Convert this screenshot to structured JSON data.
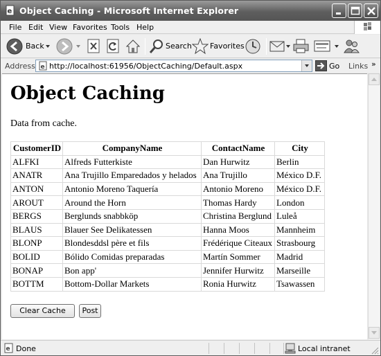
{
  "window": {
    "title": "Object Caching - Microsoft Internet Explorer"
  },
  "menu": {
    "items": [
      "File",
      "Edit",
      "View",
      "Favorites",
      "Tools",
      "Help"
    ]
  },
  "toolbar": {
    "back_label": "Back",
    "search_label": "Search",
    "favorites_label": "Favorites"
  },
  "address": {
    "label": "Address",
    "url": "http://localhost:61956/ObjectCaching/Default.aspx",
    "go_label": "Go",
    "links_label": "Links"
  },
  "page": {
    "title": "Object Caching",
    "intro": "Data from cache.",
    "table": {
      "headers": [
        "CustomerID",
        "CompanyName",
        "ContactName",
        "City"
      ],
      "rows": [
        [
          "ALFKI",
          "Alfreds Futterkiste",
          "Dan Hurwitz",
          "Berlin"
        ],
        [
          "ANATR",
          "Ana Trujillo Emparedados y helados",
          "Ana Trujillo",
          "México D.F."
        ],
        [
          "ANTON",
          "Antonio Moreno Taquería",
          "Antonio Moreno",
          "México D.F."
        ],
        [
          "AROUT",
          "Around the Horn",
          "Thomas Hardy",
          "London"
        ],
        [
          "BERGS",
          "Berglunds snabbköp",
          "Christina Berglund",
          "Luleå"
        ],
        [
          "BLAUS",
          "Blauer See Delikatessen",
          "Hanna Moos",
          "Mannheim"
        ],
        [
          "BLONP",
          "Blondesddsl père et fils",
          "Frédérique Citeaux",
          "Strasbourg"
        ],
        [
          "BOLID",
          "Bólido Comidas preparadas",
          "Martín Sommer",
          "Madrid"
        ],
        [
          "BONAP",
          "Bon app'",
          "Jennifer Hurwitz",
          "Marseille"
        ],
        [
          "BOTTM",
          "Bottom-Dollar Markets",
          "Ronia Hurwitz",
          "Tsawassen"
        ]
      ]
    },
    "clear_cache_label": "Clear Cache",
    "post_label": "Post"
  },
  "status": {
    "text": "Done",
    "zone": "Local intranet"
  }
}
